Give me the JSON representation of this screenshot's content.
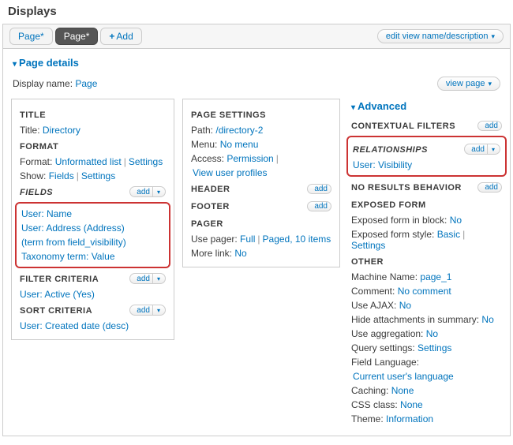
{
  "header": "Displays",
  "tabs": {
    "page1": "Page*",
    "page2": "Page*",
    "add": "Add"
  },
  "edit_link": "edit view name/description",
  "details": {
    "title": "Page details",
    "display_name_label": "Display name:",
    "display_name_value": "Page",
    "view_page_btn": "view page"
  },
  "col1": {
    "title_h": "TITLE",
    "title_label": "Title:",
    "title_value": "Directory",
    "format_h": "FORMAT",
    "format_label": "Format:",
    "format_value": "Unformatted list",
    "settings": "Settings",
    "show_label": "Show:",
    "show_value": "Fields",
    "fields_h": "FIELDS",
    "add": "add",
    "f1": "User: Name",
    "f2": "User: Address (Address)",
    "f3": "(term from field_visibility)",
    "f4": "Taxonomy term: Value",
    "filter_h": "FILTER CRITERIA",
    "filter1": "User: Active (Yes)",
    "sort_h": "SORT CRITERIA",
    "sort1": "User: Created date (desc)"
  },
  "col2": {
    "ps_h": "PAGE SETTINGS",
    "path_label": "Path:",
    "path_value": "/directory-2",
    "menu_label": "Menu:",
    "menu_value": "No menu",
    "access_label": "Access:",
    "access_value": "Permission",
    "access_sub": "View user profiles",
    "header_h": "HEADER",
    "footer_h": "FOOTER",
    "pager_h": "PAGER",
    "pager_label": "Use pager:",
    "pager_value": "Full",
    "pager_items": "Paged, 10 items",
    "more_label": "More link:",
    "more_value": "No",
    "add": "add"
  },
  "col3": {
    "adv_h": "Advanced",
    "cf_h": "CONTEXTUAL FILTERS",
    "rel_h": "RELATIONSHIPS",
    "rel1": "User: Visibility",
    "nrb_h": "NO RESULTS BEHAVIOR",
    "ef_h": "EXPOSED FORM",
    "ef_block_label": "Exposed form in block:",
    "ef_block_value": "No",
    "ef_style_label": "Exposed form style:",
    "ef_style_value": "Basic",
    "other_h": "OTHER",
    "mn_label": "Machine Name:",
    "mn_value": "page_1",
    "comment_label": "Comment:",
    "comment_value": "No comment",
    "ajax_label": "Use AJAX:",
    "ajax_value": "No",
    "hide_label": "Hide attachments in summary:",
    "hide_value": "No",
    "agg_label": "Use aggregation:",
    "agg_value": "No",
    "qs_label": "Query settings:",
    "qs_value": "Settings",
    "fl_label": "Field Language:",
    "fl_value": "Current user's language",
    "caching_label": "Caching:",
    "caching_value": "None",
    "css_label": "CSS class:",
    "css_value": "None",
    "theme_label": "Theme:",
    "theme_value": "Information",
    "add": "add",
    "settings": "Settings"
  }
}
